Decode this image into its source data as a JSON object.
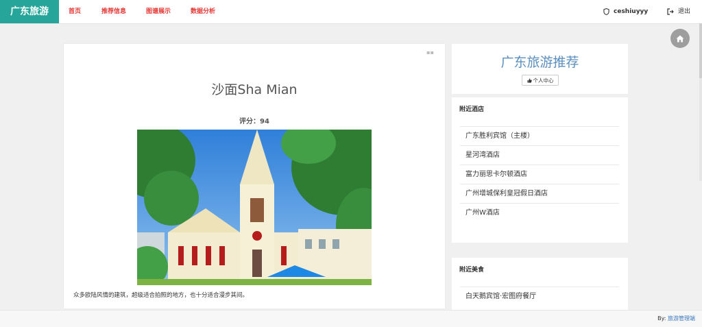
{
  "navbar": {
    "brand": "广东旅游",
    "links": [
      "首页",
      "推荐信息",
      "图谱展示",
      "数据分析"
    ],
    "user": "ceshiuyyy",
    "logout": "退出"
  },
  "place": {
    "title": "沙面Sha Mian",
    "score": "评分：94",
    "description": "众多欧陆风情的建筑，超级适合拍照的地方，也十分适合漫步其间。"
  },
  "sidebar": {
    "title": "广东旅游推荐",
    "center_button": "个人中心",
    "hotels": {
      "heading": "附近酒店",
      "items": [
        "广东胜利宾馆（主楼）",
        "星河湾酒店",
        "富力丽思卡尔顿酒店",
        "广州增城保利皇冠假日酒店",
        "广州W酒店"
      ]
    },
    "food": {
      "heading": "附近美食",
      "items": [
        "白天鹅宾馆·宏图府餐厅"
      ]
    }
  },
  "footer": {
    "by": "By:",
    "link": "旅游管理端"
  },
  "colors": {
    "brand": "#26a69a",
    "nav_link": "#e53935",
    "side_title": "#5b8fbf"
  },
  "icons": [
    "shield-icon",
    "logout-icon",
    "home-icon",
    "thumbs-up-icon"
  ]
}
